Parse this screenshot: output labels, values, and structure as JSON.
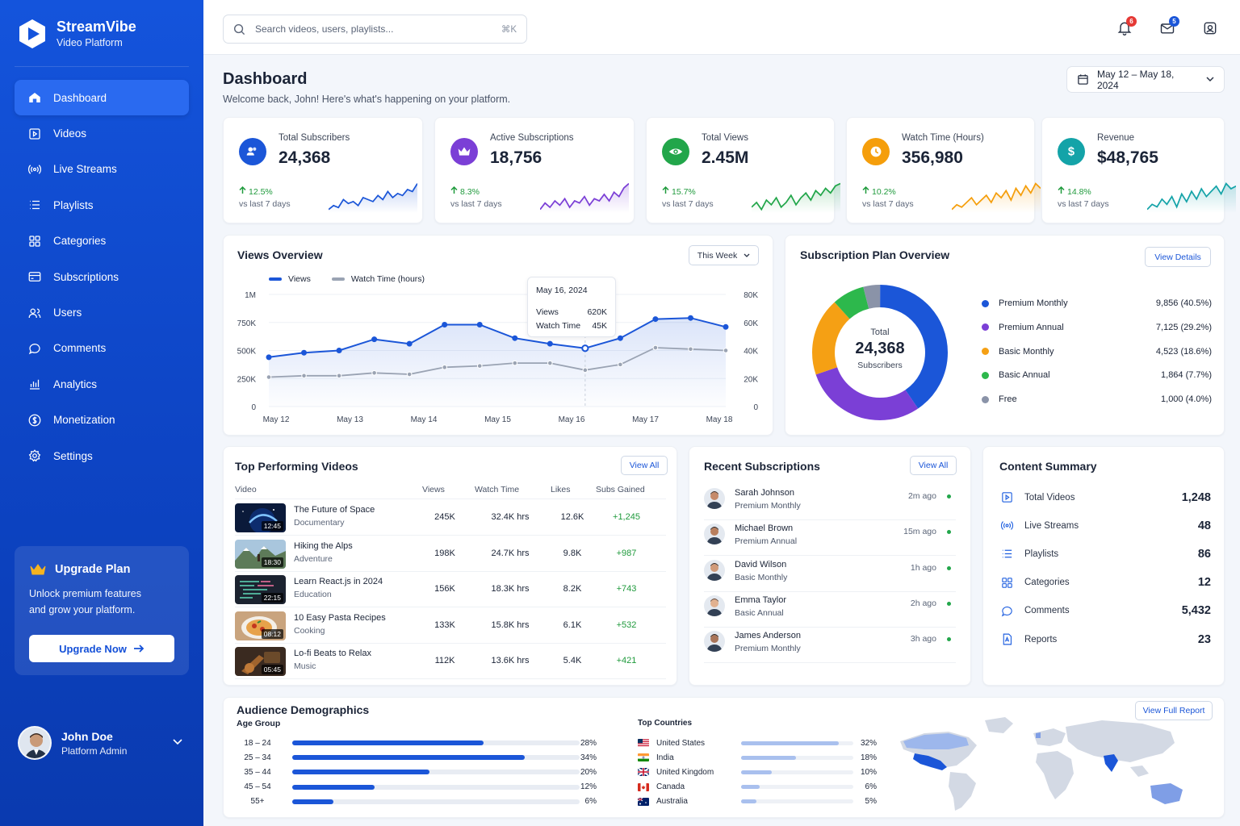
{
  "brand": {
    "title": "StreamVibe",
    "subtitle": "Video Platform"
  },
  "nav": [
    {
      "label": "Dashboard",
      "icon": "home-icon",
      "active": true
    },
    {
      "label": "Videos",
      "icon": "video-icon"
    },
    {
      "label": "Live Streams",
      "icon": "live-stream-icon"
    },
    {
      "label": "Playlists",
      "icon": "playlist-icon"
    },
    {
      "label": "Categories",
      "icon": "categories-icon"
    },
    {
      "label": "Subscriptions",
      "icon": "subscriptions-icon"
    },
    {
      "label": "Users",
      "icon": "users-icon"
    },
    {
      "label": "Comments",
      "icon": "comment-icon"
    },
    {
      "label": "Analytics",
      "icon": "analytics-icon"
    },
    {
      "label": "Monetization",
      "icon": "dollar-icon"
    },
    {
      "label": "Settings",
      "icon": "gear-icon"
    }
  ],
  "upgrade": {
    "title": "Upgrade Plan",
    "desc1": "Unlock premium features",
    "desc2": "and grow your platform.",
    "button": "Upgrade Now"
  },
  "user": {
    "name": "John Doe",
    "role": "Platform Admin"
  },
  "search": {
    "placeholder": "Search videos, users, playlists...",
    "shortcut": "⌘K"
  },
  "topbar": {
    "notifications_count": "6",
    "messages_count": "5"
  },
  "page": {
    "title": "Dashboard",
    "subtitle": "Welcome back, John! Here's what's happening on your platform.",
    "date_range": "May 12 – May 18, 2024"
  },
  "stats": [
    {
      "label": "Total Subscribers",
      "value": "24,368",
      "change": "12.5%",
      "period": "vs last 7 days",
      "color": "#1b56d8",
      "icon": "users-icon",
      "spark": [
        3,
        5,
        4,
        8,
        6,
        7,
        5,
        9,
        8,
        7,
        10,
        8,
        12,
        9,
        11,
        10,
        13,
        12,
        16
      ]
    },
    {
      "label": "Active Subscriptions",
      "value": "18,756",
      "change": "8.3%",
      "period": "vs last 7 days",
      "color": "#7b3fd6",
      "icon": "crown-icon",
      "spark": [
        3,
        6,
        4,
        7,
        5,
        8,
        4,
        7,
        6,
        9,
        5,
        8,
        7,
        10,
        7,
        11,
        9,
        13,
        15
      ]
    },
    {
      "label": "Total Views",
      "value": "2.45M",
      "change": "15.7%",
      "period": "vs last 7 days",
      "color": "#22a64a",
      "icon": "eye-icon",
      "spark": [
        4,
        6,
        3,
        7,
        5,
        8,
        4,
        6,
        9,
        5,
        8,
        10,
        7,
        11,
        9,
        12,
        10,
        13,
        14
      ]
    },
    {
      "label": "Watch Time (Hours)",
      "value": "356,980",
      "change": "10.2%",
      "period": "vs last 7 days",
      "color": "#f59e0b",
      "icon": "clock-icon",
      "spark": [
        3,
        5,
        4,
        6,
        8,
        5,
        7,
        9,
        6,
        10,
        8,
        11,
        7,
        12,
        9,
        13,
        10,
        14,
        12
      ]
    },
    {
      "label": "Revenue",
      "value": "$48,765",
      "change": "14.8%",
      "period": "vs last 7 days",
      "color": "#14a3a8",
      "icon": "dollar-icon",
      "spark": [
        4,
        6,
        5,
        8,
        6,
        9,
        5,
        10,
        7,
        11,
        8,
        12,
        9,
        11,
        13,
        10,
        14,
        12,
        13
      ]
    }
  ],
  "views_overview": {
    "title": "Views Overview",
    "period": "This Week",
    "legend_views": "Views",
    "legend_watch": "Watch Time (hours)",
    "tooltip": {
      "date": "May 16, 2024",
      "views_label": "Views",
      "views_value": "620K",
      "watch_label": "Watch Time",
      "watch_value": "45K"
    }
  },
  "chart_data": {
    "type": "area",
    "x": [
      "May 12",
      "May 13",
      "May 14",
      "May 15",
      "May 16",
      "May 17",
      "May 18"
    ],
    "x_points": [
      0,
      0.5,
      1,
      1.5,
      2,
      2.5,
      3,
      3.5,
      4,
      4.5,
      5,
      5.5,
      6
    ],
    "series": [
      {
        "name": "Views",
        "axis": "left",
        "color": "#1b56d8",
        "values": [
          440,
          480,
          500,
          600,
          560,
          730,
          730,
          610,
          560,
          520,
          610,
          780,
          790,
          710
        ]
      },
      {
        "name": "Watch Time (hours)",
        "axis": "right",
        "color": "#9aa3b3",
        "values": [
          21,
          22,
          22,
          24,
          23,
          28,
          29,
          31,
          31,
          26,
          30,
          42,
          41,
          40
        ]
      }
    ],
    "x_series_points": [
      0,
      0.5,
      1,
      1.5,
      2,
      2.5,
      3,
      3.5,
      4,
      4.5,
      5,
      5.5,
      6,
      6.5
    ],
    "y_left_ticks": [
      "0",
      "250K",
      "500K",
      "750K",
      "1M"
    ],
    "y_right_ticks": [
      "0",
      "20K",
      "40K",
      "60K",
      "80K"
    ],
    "y_left_range": [
      0,
      1000
    ],
    "y_right_range": [
      0,
      80
    ],
    "grid": true
  },
  "subscription_overview": {
    "title": "Subscription Plan Overview",
    "button": "View Details",
    "center_label": "Total",
    "center_value": "24,368",
    "center_sub": "Subscribers",
    "plans": [
      {
        "name": "Premium Monthly",
        "value": "9,856 (40.5%)",
        "pct": 40.5,
        "color": "#1b56d8"
      },
      {
        "name": "Premium Annual",
        "value": "7,125 (29.2%)",
        "pct": 29.2,
        "color": "#7b3fd6"
      },
      {
        "name": "Basic Monthly",
        "value": "4,523 (18.6%)",
        "pct": 18.6,
        "color": "#f5a014"
      },
      {
        "name": "Basic Annual",
        "value": "1,864 (7.7%)",
        "pct": 7.7,
        "color": "#2db84c"
      },
      {
        "name": "Free",
        "value": "1,000 (4.0%)",
        "pct": 4.0,
        "color": "#8a93a8"
      }
    ]
  },
  "top_videos": {
    "title": "Top Performing Videos",
    "button": "View All",
    "headers": [
      "Video",
      "Views",
      "Watch Time",
      "Likes",
      "Subs Gained"
    ],
    "rows": [
      {
        "title": "The Future of Space",
        "category": "Documentary",
        "duration": "12:45",
        "views": "245K",
        "watch": "32.4K hrs",
        "likes": "12.6K",
        "subs": "+1,245"
      },
      {
        "title": "Hiking the Alps",
        "category": "Adventure",
        "duration": "18:30",
        "views": "198K",
        "watch": "24.7K hrs",
        "likes": "9.8K",
        "subs": "+987"
      },
      {
        "title": "Learn React.js in 2024",
        "category": "Education",
        "duration": "22:15",
        "views": "156K",
        "watch": "18.3K hrs",
        "likes": "8.2K",
        "subs": "+743"
      },
      {
        "title": "10 Easy Pasta Recipes",
        "category": "Cooking",
        "duration": "08:12",
        "views": "133K",
        "watch": "15.8K hrs",
        "likes": "6.1K",
        "subs": "+532"
      },
      {
        "title": "Lo-fi Beats to Relax",
        "category": "Music",
        "duration": "05:45",
        "views": "112K",
        "watch": "13.6K hrs",
        "likes": "5.4K",
        "subs": "+421"
      }
    ]
  },
  "recent_subs": {
    "title": "Recent Subscriptions",
    "button": "View All",
    "rows": [
      {
        "name": "Sarah Johnson",
        "plan": "Premium Monthly",
        "time": "2m ago"
      },
      {
        "name": "Michael Brown",
        "plan": "Premium Annual",
        "time": "15m ago"
      },
      {
        "name": "David Wilson",
        "plan": "Basic Monthly",
        "time": "1h ago"
      },
      {
        "name": "Emma Taylor",
        "plan": "Basic Annual",
        "time": "2h ago"
      },
      {
        "name": "James Anderson",
        "plan": "Premium Monthly",
        "time": "3h ago"
      }
    ]
  },
  "content_summary": {
    "title": "Content Summary",
    "rows": [
      {
        "label": "Total Videos",
        "value": "1,248",
        "icon": "video-icon"
      },
      {
        "label": "Live Streams",
        "value": "48",
        "icon": "live-stream-icon"
      },
      {
        "label": "Playlists",
        "value": "86",
        "icon": "playlist-icon"
      },
      {
        "label": "Categories",
        "value": "12",
        "icon": "categories-icon"
      },
      {
        "label": "Comments",
        "value": "5,432",
        "icon": "comment-icon"
      },
      {
        "label": "Reports",
        "value": "23",
        "icon": "report-icon"
      }
    ]
  },
  "demographics": {
    "title": "Audience Demographics",
    "age_title": "Age Group",
    "countries_title": "Top Countries",
    "button": "View Full Report",
    "ages": [
      {
        "label": "18 – 24",
        "pct": "28%",
        "value": 28
      },
      {
        "label": "25 – 34",
        "pct": "34%",
        "value": 34
      },
      {
        "label": "35 – 44",
        "pct": "20%",
        "value": 20
      },
      {
        "label": "45 – 54",
        "pct": "12%",
        "value": 12
      },
      {
        "label": "55+",
        "pct": "6%",
        "value": 6
      }
    ],
    "countries": [
      {
        "name": "United States",
        "pct": "32%",
        "value": 32,
        "flag": "us"
      },
      {
        "name": "India",
        "pct": "18%",
        "value": 18,
        "flag": "in"
      },
      {
        "name": "United Kingdom",
        "pct": "10%",
        "value": 10,
        "flag": "gb"
      },
      {
        "name": "Canada",
        "pct": "6%",
        "value": 6,
        "flag": "ca"
      },
      {
        "name": "Australia",
        "pct": "5%",
        "value": 5,
        "flag": "au"
      }
    ]
  }
}
